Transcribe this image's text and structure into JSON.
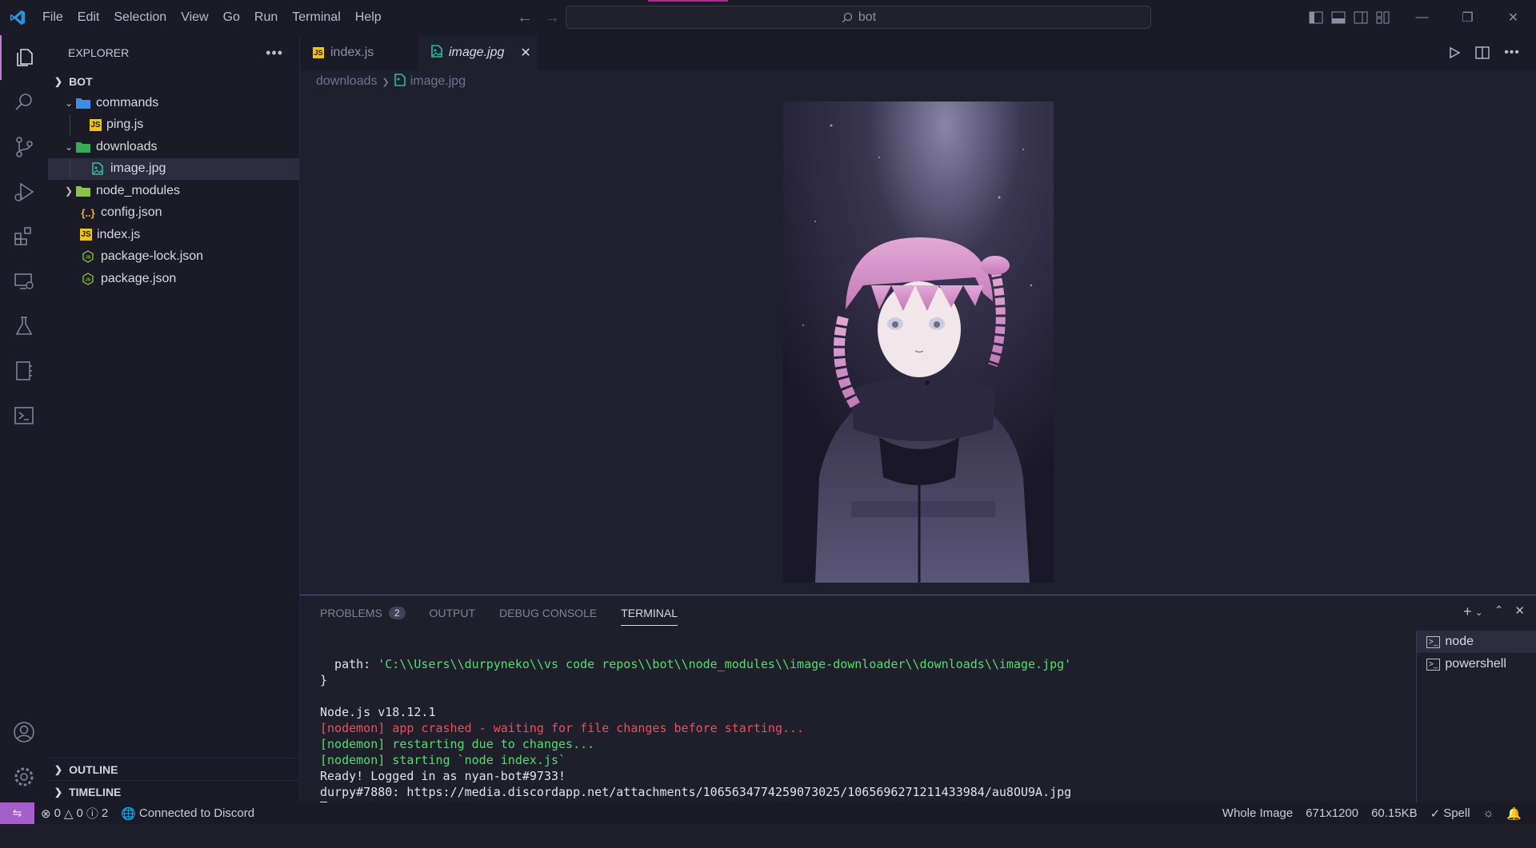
{
  "menu": [
    "File",
    "Edit",
    "Selection",
    "View",
    "Go",
    "Run",
    "Terminal",
    "Help"
  ],
  "command_center": "bot",
  "explorer": {
    "title": "EXPLORER",
    "root": "BOT",
    "items": [
      {
        "label": "commands",
        "type": "folder",
        "expanded": true,
        "depth": 1
      },
      {
        "label": "ping.js",
        "type": "js",
        "depth": 2
      },
      {
        "label": "downloads",
        "type": "folder-green",
        "expanded": true,
        "depth": 1
      },
      {
        "label": "image.jpg",
        "type": "image",
        "depth": 2,
        "selected": true
      },
      {
        "label": "node_modules",
        "type": "folder-node",
        "expanded": false,
        "depth": 1
      },
      {
        "label": "config.json",
        "type": "json",
        "depth": 1
      },
      {
        "label": "index.js",
        "type": "js",
        "depth": 1
      },
      {
        "label": "package-lock.json",
        "type": "npm",
        "depth": 1
      },
      {
        "label": "package.json",
        "type": "npm",
        "depth": 1
      }
    ],
    "outline": "OUTLINE",
    "timeline": "TIMELINE"
  },
  "tabs": [
    {
      "label": "index.js",
      "active": false
    },
    {
      "label": "image.jpg",
      "active": true
    }
  ],
  "breadcrumb": {
    "folder": "downloads",
    "file": "image.jpg"
  },
  "panel": {
    "tabs": [
      "PROBLEMS",
      "OUTPUT",
      "DEBUG CONSOLE",
      "TERMINAL"
    ],
    "problems_count": "2",
    "terminal_lines": [
      {
        "text": "  path: ",
        "cls": "",
        "extra": "'C:\\\\Users\\\\durpyneko\\\\vs code repos\\\\bot\\\\node_modules\\\\image-downloader\\\\downloads\\\\image.jpg'",
        "extra_cls": "green"
      },
      {
        "text": "}",
        "cls": ""
      },
      {
        "text": "",
        "cls": ""
      },
      {
        "text": "Node.js v18.12.1",
        "cls": ""
      },
      {
        "text": "[nodemon] app crashed - waiting for file changes before starting...",
        "cls": "red"
      },
      {
        "text": "[nodemon] restarting due to changes...",
        "cls": "green"
      },
      {
        "text": "[nodemon] starting `node index.js`",
        "cls": "green"
      },
      {
        "text": "Ready! Logged in as nyan-bot#9733!",
        "cls": ""
      },
      {
        "text": "durpy#7880: https://media.discordapp.net/attachments/1065634774259073025/1065696271211433984/au8OU9A.jpg",
        "cls": ""
      }
    ],
    "terminals": [
      "node",
      "powershell"
    ]
  },
  "status": {
    "errors": "0",
    "warnings": "0",
    "info": "2",
    "discord": "Connected to Discord",
    "zoom": "Whole Image",
    "dimensions": "671x1200",
    "size": "60.15KB",
    "spell": "Spell"
  },
  "colors": {
    "accent": "#a55fc8",
    "bg": "#1a1b26",
    "editor": "#1f202e"
  }
}
